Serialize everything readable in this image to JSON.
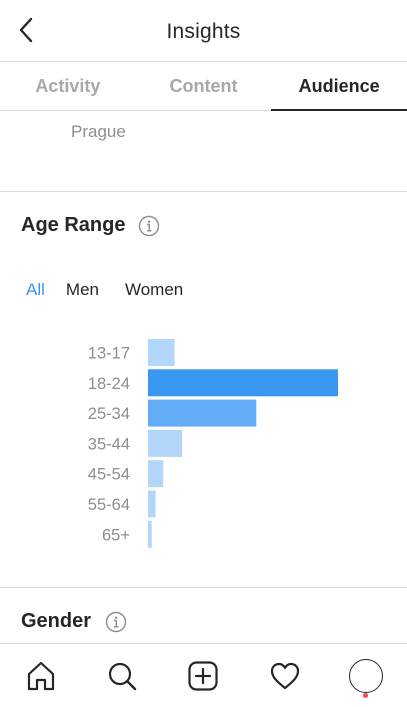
{
  "header": {
    "title": "Insights",
    "back_icon": "chevron-left-icon"
  },
  "tabs": [
    {
      "label": "Activity",
      "active": false
    },
    {
      "label": "Content",
      "active": false
    },
    {
      "label": "Audience",
      "active": true
    }
  ],
  "location": {
    "city": "Prague"
  },
  "age_section": {
    "title": "Age Range",
    "info_icon": "info-icon",
    "filters": [
      {
        "label": "All",
        "active": true
      },
      {
        "label": "Men",
        "active": false
      },
      {
        "label": "Women",
        "active": false
      }
    ]
  },
  "chart_data": {
    "type": "bar",
    "orientation": "horizontal",
    "categories": [
      "13-17",
      "18-24",
      "25-34",
      "35-44",
      "45-54",
      "55-64",
      "65+"
    ],
    "values": [
      14,
      100,
      57,
      18,
      8,
      4,
      2
    ],
    "title": "",
    "xlabel": "",
    "ylabel": "",
    "xlim": [
      0,
      100
    ],
    "grid": false,
    "colors": {
      "top": "#3897f0",
      "second": "#62adf5",
      "rest": "#b3d7fa"
    }
  },
  "gender_section": {
    "title": "Gender",
    "info_icon": "info-icon"
  },
  "bottom_nav": [
    {
      "icon": "home-icon"
    },
    {
      "icon": "search-icon"
    },
    {
      "icon": "add-post-icon"
    },
    {
      "icon": "heart-icon"
    },
    {
      "icon": "profile-avatar"
    }
  ]
}
